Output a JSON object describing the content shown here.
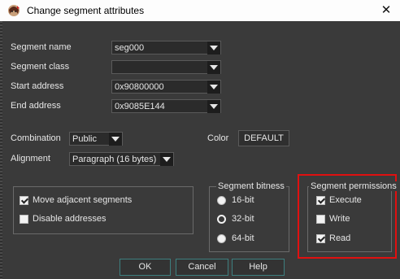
{
  "window": {
    "title": "Change segment attributes",
    "close_glyph": "✕"
  },
  "fields": {
    "segment_name": {
      "label": "Segment name",
      "value": "seg000"
    },
    "segment_class": {
      "label": "Segment class",
      "value": ""
    },
    "start_address": {
      "label": "Start address",
      "value": "0x90800000"
    },
    "end_address": {
      "label": "End address",
      "value": "0x9085E144"
    }
  },
  "combination": {
    "label": "Combination",
    "value": "Public"
  },
  "alignment": {
    "label": "Alignment",
    "value": "Paragraph (16 bytes)"
  },
  "color": {
    "label": "Color",
    "value": "DEFAULT"
  },
  "options": [
    {
      "label": "Move adjacent segments",
      "checked": true
    },
    {
      "label": "Disable addresses",
      "checked": false
    }
  ],
  "bitness": {
    "title": "Segment bitness",
    "options": [
      {
        "label": "16-bit",
        "selected": false
      },
      {
        "label": "32-bit",
        "selected": true
      },
      {
        "label": "64-bit",
        "selected": false
      }
    ]
  },
  "permissions": {
    "title": "Segment permissions",
    "options": [
      {
        "label": "Execute",
        "checked": true
      },
      {
        "label": "Write",
        "checked": false
      },
      {
        "label": "Read",
        "checked": true
      }
    ]
  },
  "buttons": {
    "ok": "OK",
    "cancel": "Cancel",
    "help": "Help"
  },
  "colors": {
    "highlight": "#e01010",
    "accent_border": "#3d7f7f",
    "background": "#3a3a3a"
  }
}
